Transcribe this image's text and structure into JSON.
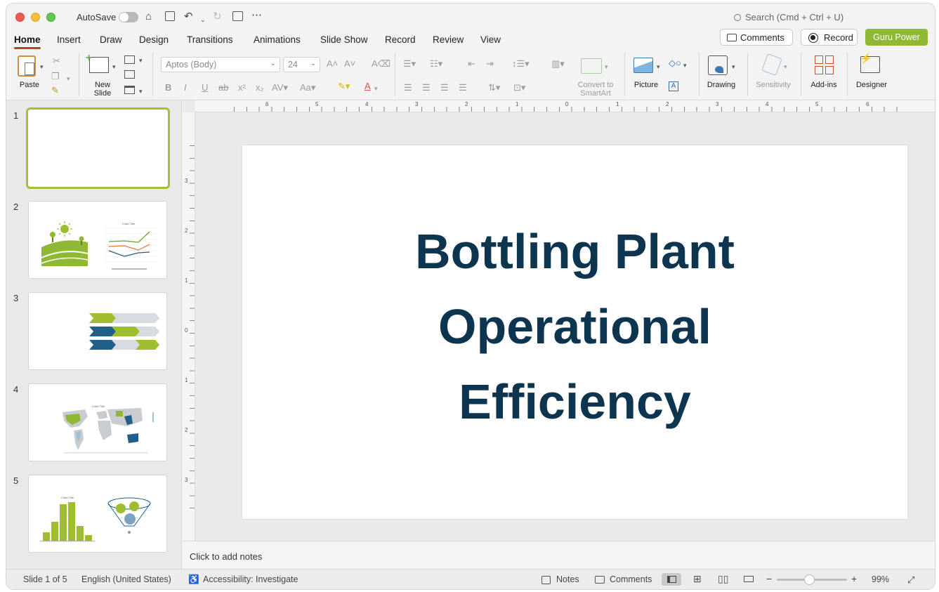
{
  "titlebar": {
    "autosave_label": "AutoSave",
    "search_placeholder": "Search (Cmd + Ctrl + U)"
  },
  "tabs": [
    {
      "label": "Home",
      "active": true
    },
    {
      "label": "Insert"
    },
    {
      "label": "Draw"
    },
    {
      "label": "Design"
    },
    {
      "label": "Transitions"
    },
    {
      "label": "Animations"
    },
    {
      "label": "Slide Show"
    },
    {
      "label": "Record"
    },
    {
      "label": "Review"
    },
    {
      "label": "View"
    }
  ],
  "header_buttons": {
    "comments": "Comments",
    "record": "Record",
    "guru": "Guru Power"
  },
  "ribbon": {
    "paste": "Paste",
    "new_slide_1": "New",
    "new_slide_2": "Slide",
    "font_name": "Aptos (Body)",
    "font_size": "24",
    "convert_1": "Convert to",
    "convert_2": "SmartArt",
    "picture": "Picture",
    "drawing": "Drawing",
    "sensitivity": "Sensitivity",
    "addins": "Add-ins",
    "designer": "Designer"
  },
  "thumbnails": [
    {
      "num": "1"
    },
    {
      "num": "2",
      "chart_title": "Chart Title"
    },
    {
      "num": "3"
    },
    {
      "num": "4",
      "chart_title": "Chart Title"
    },
    {
      "num": "5",
      "chart_title": "Chart Title"
    }
  ],
  "slide": {
    "title_line1": "Bottling Plant",
    "title_line2": "Operational",
    "title_line3": "Efficiency"
  },
  "notes_placeholder": "Click to add notes",
  "status": {
    "slide_of": "Slide 1 of 5",
    "language": "English (United States)",
    "accessibility": "Accessibility: Investigate",
    "notes": "Notes",
    "comments": "Comments",
    "zoom": "99%"
  },
  "colors": {
    "accent_green": "#8fb934",
    "title_navy": "#0d3550",
    "tab_underline": "#c43e1c"
  }
}
